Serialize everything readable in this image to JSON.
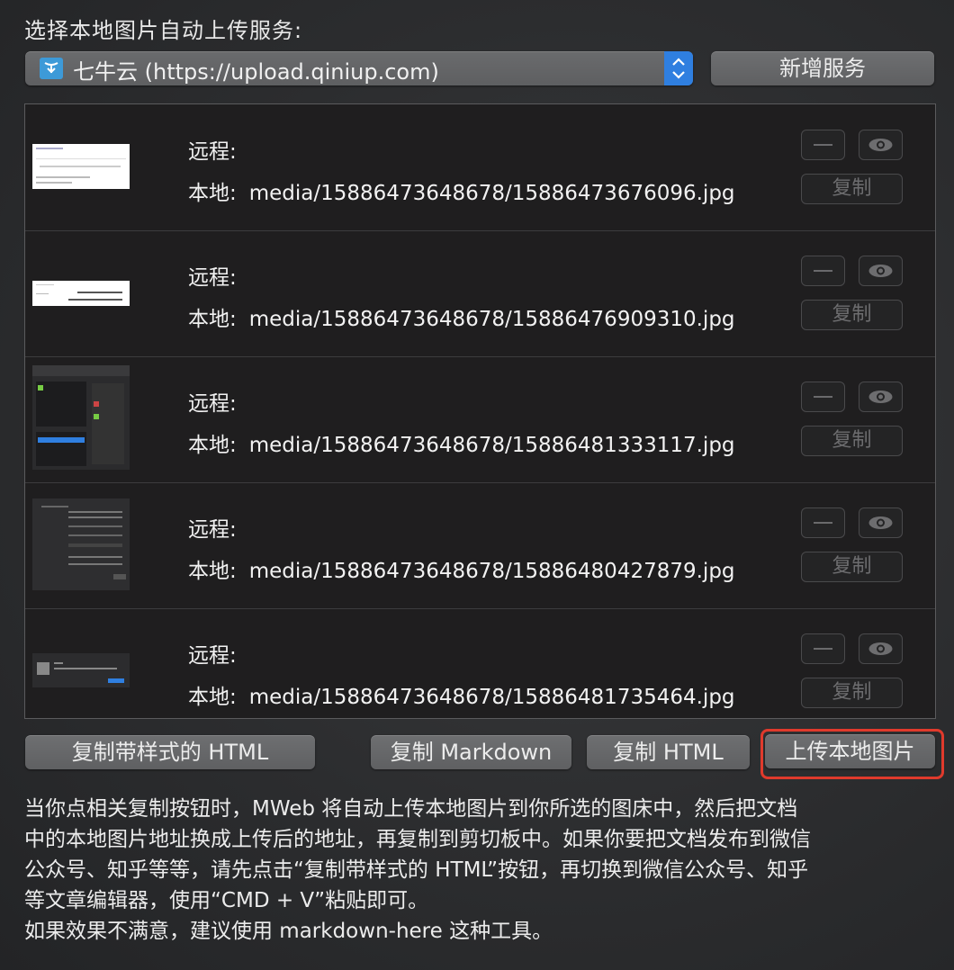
{
  "header": {
    "title": "选择本地图片自动上传服务:"
  },
  "service_select": {
    "icon": "qiniu-logo-icon",
    "value": "七牛云 (https://upload.qiniup.com)",
    "options_icon": "chevron-up-down-icon"
  },
  "add_service_button": "新增服务",
  "images": [
    {
      "remote_label": "远程:",
      "local_label": "本地:",
      "path": "media/15886473648678/15886473676096.jpg",
      "copy_label": "复制"
    },
    {
      "remote_label": "远程:",
      "local_label": "本地:",
      "path": "media/15886473648678/15886476909310.jpg",
      "copy_label": "复制"
    },
    {
      "remote_label": "远程:",
      "local_label": "本地:",
      "path": "media/15886473648678/15886481333117.jpg",
      "copy_label": "复制"
    },
    {
      "remote_label": "远程:",
      "local_label": "本地:",
      "path": "media/15886473648678/15886480427879.jpg",
      "copy_label": "复制"
    },
    {
      "remote_label": "远程:",
      "local_label": "本地:",
      "path": "media/15886473648678/15886481735464.jpg",
      "copy_label": "复制"
    }
  ],
  "footer_buttons": {
    "copy_styled_html": "复制带样式的 HTML",
    "copy_markdown": "复制 Markdown",
    "copy_html": "复制 HTML",
    "upload_local_images": "上传本地图片"
  },
  "description": {
    "line1": "当你点相关复制按钮时，MWeb 将自动上传本地图片到你所选的图床中，然后把文档",
    "line2": "中的本地图片地址换成上传后的地址，再复制到剪切板中。如果你要把文档发布到微信",
    "line3": "公众号、知乎等等，请先点击“复制带样式的 HTML”按钮，再切换到微信公众号、知乎",
    "line4": "等文章编辑器，使用“CMD + V”粘贴即可。",
    "line5": "如果效果不满意，建议使用 markdown-here 这种工具。"
  },
  "colors": {
    "accent": "#2f7fe0",
    "highlight": "#e03a2c",
    "qiniu": "#3d9ad8"
  }
}
